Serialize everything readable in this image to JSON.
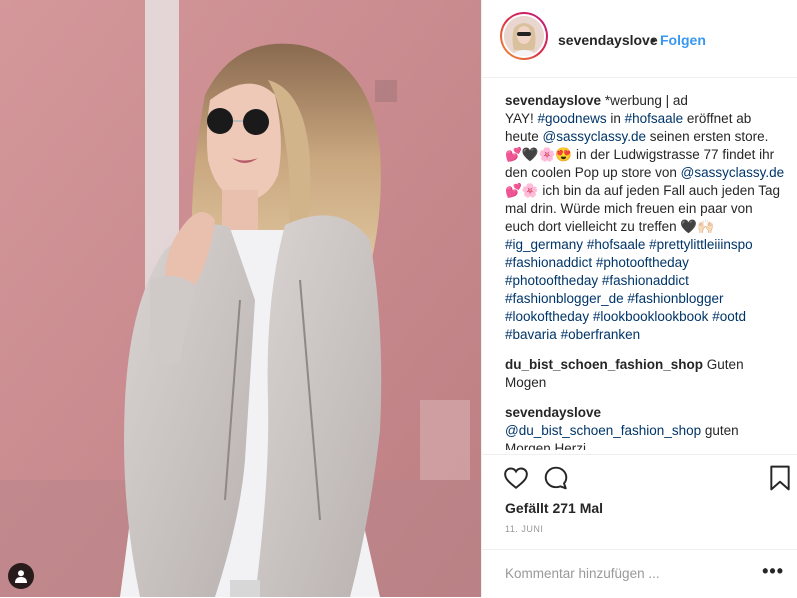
{
  "post": {
    "username": "sevendayslove",
    "separator": "•",
    "follow_label": "Folgen",
    "likes_label": "Gefällt 271 Mal",
    "date_label": "11. JUNI",
    "comment_placeholder": "Kommentar hinzufügen ...",
    "more_label": "•••"
  },
  "caption": {
    "user": "sevendayslove",
    "l1": " *werbung | ad",
    "l2a": "YAY! ",
    "tag_goodnews": "#goodnews",
    "l2b": " in ",
    "tag_hofsaale1": "#hofsaale",
    "l2c": " eröffnet ab heute ",
    "mention1": "@sassyclassy.de",
    "l2d": " seinen ersten store. 💕🖤🌸😍 in der Ludwigstrasse 77 findet ihr den coolen Pop up store von ",
    "mention2": "@sassyclassy.de",
    "l2e": " 💕🌸 ich bin da auf jeden Fall auch jeden Tag mal drin. Würde mich freuen ein paar von euch dort vielleicht zu treffen 🖤🙌🏻 ",
    "hashtags": [
      "#ig_germany",
      "#hofsaale",
      "#prettylittleiiinspo",
      "#fashionaddict",
      "#photooftheday",
      "#photooftheday",
      "#fashionaddict",
      "#fashionblogger_de",
      "#fashionblogger",
      "#lookoftheday",
      "#lookbooklookbook",
      "#ootd",
      "#bavaria",
      "#oberfranken"
    ]
  },
  "comments": [
    {
      "user": "du_bist_schoen_fashion_shop",
      "text": " Guten Mogen"
    },
    {
      "user": "sevendayslove",
      "mention": "@du_bist_schoen_fashion_shop",
      "text": " guten Morgen Herzi"
    }
  ],
  "colors": {
    "link_blue": "#3897f0",
    "hashtag_blue": "#003569",
    "text": "#262626",
    "muted": "#999999",
    "wall_pink": "#c98b8e"
  },
  "icons": {
    "like": "heart-outline-icon",
    "comment": "speech-bubble-icon",
    "save": "bookmark-outline-icon",
    "tag": "person-tag-icon"
  }
}
